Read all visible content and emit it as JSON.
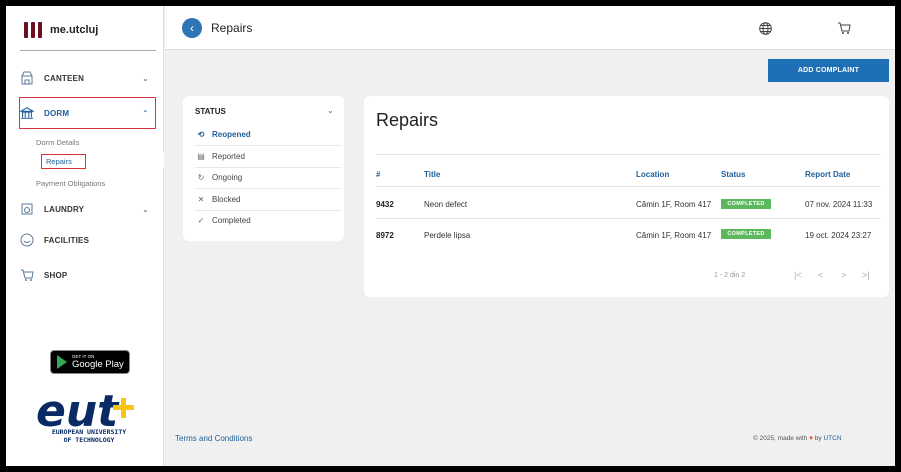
{
  "brand": {
    "name": "me.utcluj"
  },
  "sidebar": {
    "items": [
      {
        "label": "CANTEEN",
        "icon": "store-icon"
      },
      {
        "label": "DORM",
        "icon": "building-icon"
      },
      {
        "label": "LAUNDRY",
        "icon": "washer-icon"
      },
      {
        "label": "FACILITIES",
        "icon": "smile-icon"
      },
      {
        "label": "SHOP",
        "icon": "cart-icon"
      }
    ],
    "dorm_sub": [
      "Dorm Details",
      "Repairs",
      "Payment Obligations"
    ]
  },
  "header": {
    "title": "Repairs"
  },
  "actions": {
    "add_complaint": "ADD COMPLAINT"
  },
  "status_filter": {
    "heading": "STATUS",
    "items": [
      {
        "label": "Reopened",
        "icon": "reopen-icon"
      },
      {
        "label": "Reported",
        "icon": "report-icon"
      },
      {
        "label": "Ongoing",
        "icon": "refresh-icon"
      },
      {
        "label": "Blocked",
        "icon": "x-icon"
      },
      {
        "label": "Completed",
        "icon": "check-icon"
      }
    ]
  },
  "repairs": {
    "title": "Repairs",
    "columns": [
      "#",
      "Title",
      "Location",
      "Status",
      "Report Date"
    ],
    "rows": [
      {
        "id": "9432",
        "title": "Neon defect",
        "location": "Cămin 1F, Room 417",
        "status": "COMPLETED",
        "date": "07 nov. 2024 11:33"
      },
      {
        "id": "8972",
        "title": "Perdele lipsa",
        "location": "Cămin 1F, Room 417",
        "status": "COMPLETED",
        "date": "19 oct. 2024 23:27"
      }
    ],
    "pager": {
      "count": "1 - 2 din 2",
      "first": "|<",
      "prev": "<",
      "next": ">",
      "last": ">|"
    }
  },
  "store_badge": {
    "small": "GET IT ON",
    "big": "Google Play"
  },
  "eut": {
    "line1": "EUROPEAN UNIVERSITY",
    "line2": "OF TECHNOLOGY"
  },
  "footer": {
    "terms": "Terms and Conditions",
    "copy_prefix": "© 2025, made with",
    "copy_by": "by",
    "copy_link": "UTCN"
  },
  "colors": {
    "accent": "#1e6fb6",
    "highlight_border": "#d9343a",
    "badge": "#5cb85c",
    "brand": "#6b1020"
  }
}
